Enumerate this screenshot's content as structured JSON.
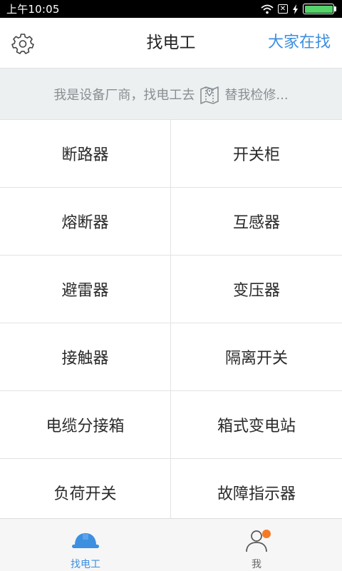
{
  "status_bar": {
    "time": "上午10:05",
    "battery_level": 1.0
  },
  "header": {
    "title": "找电工",
    "right_link": "大家在找"
  },
  "banner": {
    "text_before": "我是设备厂商，找电工去",
    "text_after": "替我检修..."
  },
  "categories": [
    "断路器",
    "开关柜",
    "熔断器",
    "互感器",
    "避雷器",
    "变压器",
    "接触器",
    "隔离开关",
    "电缆分接箱",
    "箱式变电站",
    "负荷开关",
    "故障指示器"
  ],
  "tabs": [
    {
      "label": "找电工",
      "icon": "hard-hat-icon",
      "active": true
    },
    {
      "label": "我",
      "icon": "person-icon",
      "active": false,
      "badge": true
    }
  ],
  "colors": {
    "accent": "#3d8fe0",
    "badge": "#f47a26",
    "banner_bg": "#edf0f1",
    "battery": "#55d26a"
  }
}
